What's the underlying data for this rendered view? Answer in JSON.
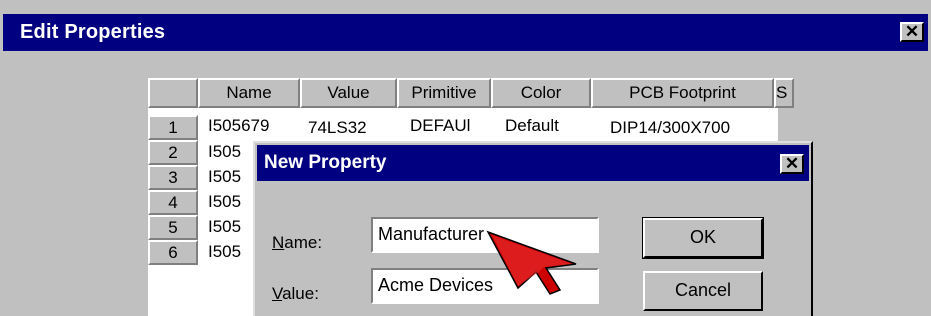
{
  "window": {
    "title": "Edit Properties",
    "close_glyph": "✕"
  },
  "grid": {
    "columns": [
      "Name",
      "Value",
      "Primitive",
      "Color",
      "PCB Footprint",
      "S"
    ],
    "rows": [
      {
        "num": "1",
        "name": "I505679",
        "value": "74LS32",
        "primitive": "DEFAUl",
        "color": "Default",
        "footprint": "DIP14/300X700"
      },
      {
        "num": "2",
        "name": "I505"
      },
      {
        "num": "3",
        "name": "I505"
      },
      {
        "num": "4",
        "name": "I505"
      },
      {
        "num": "5",
        "name": "I505"
      },
      {
        "num": "6",
        "name": "I505"
      }
    ]
  },
  "dialog": {
    "title": "New Property",
    "close_glyph": "✕",
    "name_label_accel": "N",
    "name_label_rest": "ame:",
    "name_value": "Manufacturer",
    "value_label_accel": "V",
    "value_label_rest": "alue:",
    "value_value": "Acme Devices",
    "ok_label": "OK",
    "cancel_label": "Cancel"
  },
  "pointer": {
    "icon": "pointer-arrow-icon",
    "color": "#cc0000"
  },
  "colors": {
    "titlebar": "#000080",
    "face": "#c0c0c0"
  }
}
